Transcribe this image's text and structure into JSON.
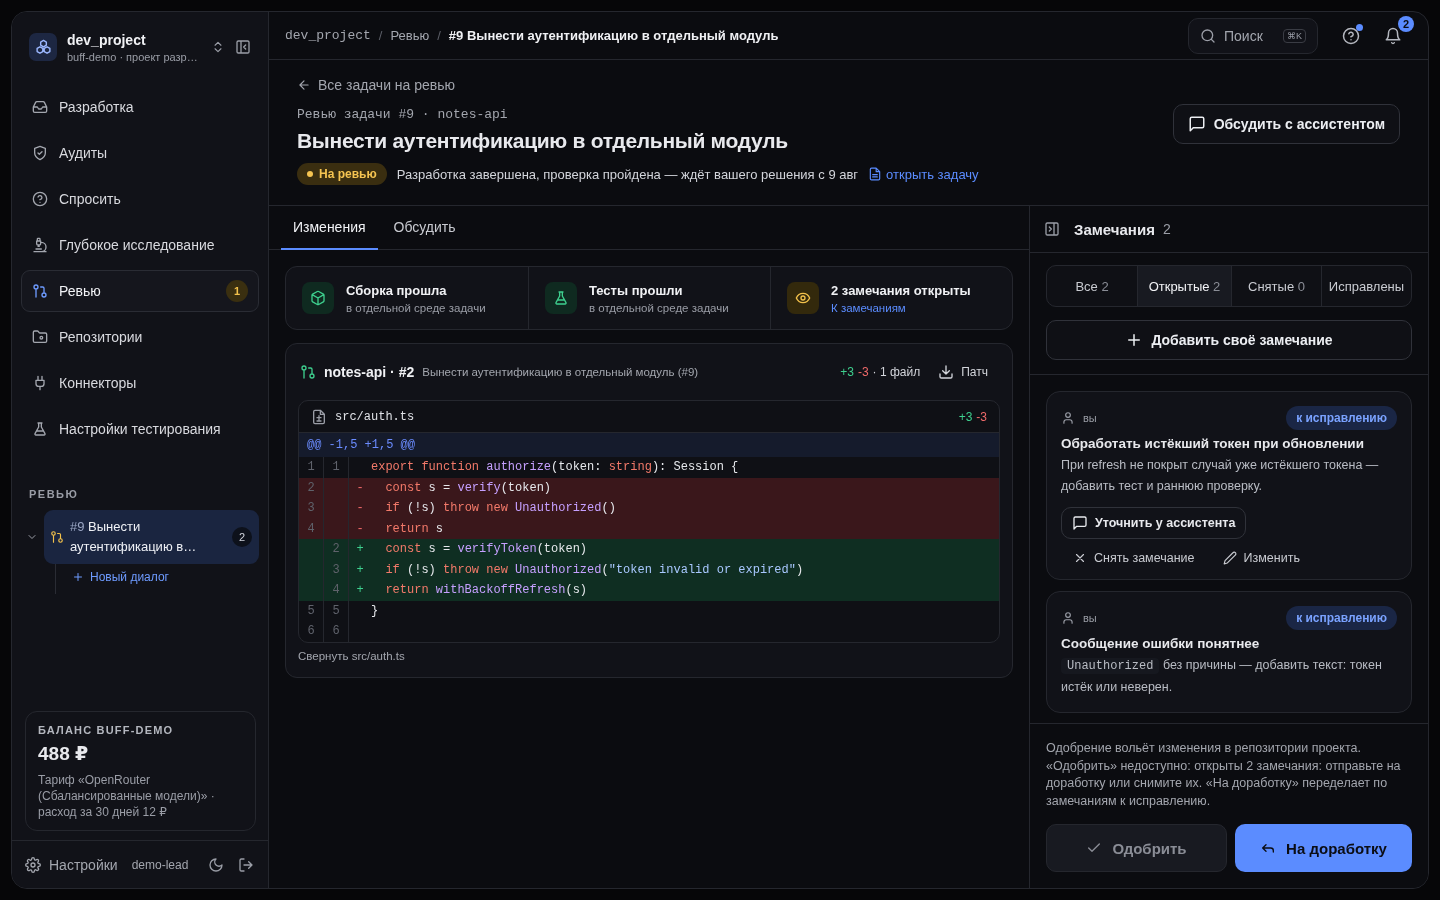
{
  "sidebar": {
    "project": {
      "name": "dev_project",
      "subtitle": "buff-demo · проект разр…"
    },
    "nav": [
      {
        "label": "Разработка",
        "selected": false
      },
      {
        "label": "Аудиты",
        "selected": false
      },
      {
        "label": "Спросить",
        "selected": false
      },
      {
        "label": "Глубокое исследование",
        "selected": false
      },
      {
        "label": "Ревью",
        "selected": true,
        "badge": "1"
      },
      {
        "label": "Репозитории",
        "selected": false
      },
      {
        "label": "Коннекторы",
        "selected": false
      },
      {
        "label": "Настройки тестирования",
        "selected": false
      }
    ],
    "section_title": "РЕВЬЮ",
    "tree": [
      {
        "number": "#9",
        "title": "Вынести аутентификацию в…",
        "badge": "2",
        "selected": true,
        "expanded": true,
        "children": [
          {
            "label": "Новый диалог"
          }
        ]
      }
    ],
    "balance": {
      "title": "БАЛАНС BUFF-DEMO",
      "amount": "488 ₽",
      "note": "Тариф «OpenRouter (Сбалансированные модели)» · расход за 30 дней 12 ₽"
    },
    "footer": {
      "settings": "Настройки",
      "user": "demo-lead"
    }
  },
  "topbar": {
    "separator": "/",
    "breadcrumbs": [
      "dev_project",
      "Ревью",
      "#9 Вынести аутентификацию в отдельный модуль"
    ],
    "search": {
      "placeholder": "Поиск",
      "shortcut": "⌘K"
    },
    "help_unread": true,
    "notifications": "2"
  },
  "header": {
    "back": "Все задачи на ревью",
    "eyebrow": "Ревью задачи #9 · notes-api",
    "title": "Вынести аутентификацию в отдельный модуль",
    "status": "На ревью",
    "summary": "Разработка завершена, проверка пройдена — ждёт вашего решения с 9 авг",
    "task_link": "открыть задачу",
    "discuss_button": "Обсудить с ассистентом"
  },
  "tabs": [
    {
      "label": "Изменения",
      "selected": true
    },
    {
      "label": "Обсудить",
      "selected": false
    }
  ],
  "checks": [
    {
      "kind": "build",
      "title": "Сборка прошла",
      "subtitle": "в отдельной среде задачи"
    },
    {
      "kind": "tests",
      "title": "Тесты прошли",
      "subtitle": "в отдельной среде задачи"
    },
    {
      "kind": "remarks",
      "title": "2 замечания открыты",
      "link": "К замечаниям"
    }
  ],
  "diff": {
    "repo": "notes-api · #2",
    "description": "Вынести аутентификацию в отдельный модуль (#9)",
    "added": "+3",
    "removed": "-3",
    "files": "· 1 файл",
    "patch": "Патч",
    "file": {
      "path": "src/auth.ts",
      "added": "+3",
      "removed": "-3",
      "hunk": "@@ -1,5 +1,5 @@",
      "lines": [
        {
          "kind": "ctx",
          "old": "1",
          "new": "1",
          "code": [
            {
              "kind": "kw",
              "text": "export"
            },
            {
              "kind": "kw",
              "text": " function"
            },
            {
              "kind": "fn",
              "text": " authorize"
            },
            {
              "kind": "plain",
              "text": "(token: "
            },
            {
              "kind": "kw",
              "text": "string"
            },
            {
              "kind": "plain",
              "text": "): Session {"
            }
          ]
        },
        {
          "kind": "del",
          "old": "2",
          "sign": "-",
          "code": [
            {
              "kind": "kw",
              "text": "  const"
            },
            {
              "kind": "plain",
              "text": " s = "
            },
            {
              "kind": "fn",
              "text": "verify"
            },
            {
              "kind": "plain",
              "text": "(token)"
            }
          ]
        },
        {
          "kind": "del",
          "old": "3",
          "sign": "-",
          "code": [
            {
              "kind": "kw",
              "text": "  if"
            },
            {
              "kind": "plain",
              "text": " (!s) "
            },
            {
              "kind": "kw",
              "text": "throw"
            },
            {
              "kind": "kw",
              "text": " new"
            },
            {
              "kind": "fn",
              "text": " Unauthorized"
            },
            {
              "kind": "plain",
              "text": "()"
            }
          ]
        },
        {
          "kind": "del",
          "old": "4",
          "sign": "-",
          "code": [
            {
              "kind": "kw",
              "text": "  return"
            },
            {
              "kind": "plain",
              "text": " s"
            }
          ]
        },
        {
          "kind": "add",
          "new": "2",
          "sign": "+",
          "code": [
            {
              "kind": "kw",
              "text": "  const"
            },
            {
              "kind": "plain",
              "text": " s = "
            },
            {
              "kind": "fn",
              "text": "verifyToken"
            },
            {
              "kind": "plain",
              "text": "(token)"
            }
          ]
        },
        {
          "kind": "add",
          "new": "3",
          "sign": "+",
          "code": [
            {
              "kind": "kw",
              "text": "  if"
            },
            {
              "kind": "plain",
              "text": " (!s) "
            },
            {
              "kind": "kw",
              "text": "throw"
            },
            {
              "kind": "kw",
              "text": " new"
            },
            {
              "kind": "fn",
              "text": " Unauthorized"
            },
            {
              "kind": "plain",
              "text": "("
            },
            {
              "kind": "str",
              "text": "\"token invalid or expired\""
            },
            {
              "kind": "plain",
              "text": ")"
            }
          ]
        },
        {
          "kind": "add",
          "new": "4",
          "sign": "+",
          "code": [
            {
              "kind": "kw",
              "text": "  return"
            },
            {
              "kind": "fn",
              "text": " withBackoffRefresh"
            },
            {
              "kind": "plain",
              "text": "(s)"
            }
          ]
        },
        {
          "kind": "ctx",
          "old": "5",
          "new": "5",
          "code": [
            {
              "kind": "plain",
              "text": "}"
            }
          ]
        },
        {
          "kind": "ctx",
          "old": "6",
          "new": "6"
        }
      ]
    },
    "collapse": "Свернуть src/auth.ts"
  },
  "remarks_panel": {
    "title": "Замечания",
    "count": "2",
    "filters": [
      {
        "label": "Все",
        "count": "2",
        "selected": false
      },
      {
        "label": "Открытые",
        "count": "2",
        "selected": true
      },
      {
        "label": "Снятые",
        "count": "0",
        "selected": false
      },
      {
        "label": "Исправлены",
        "selected": false
      }
    ],
    "add_button": "Добавить своё замечание",
    "remarks": [
      {
        "author": "вы",
        "tag": "к исправлению",
        "title": "Обработать истёкший токен при обновлении",
        "body": [
          {
            "kind": "text",
            "text": "При refresh не покрыт случай уже истёкшего токена — добавить тест и раннюю проверку."
          }
        ],
        "ask_button": "Уточнить у ассистента",
        "dismiss": "Снять замечание",
        "edit": "Изменить"
      },
      {
        "author": "вы",
        "tag": "к исправлению",
        "title": "Сообщение ошибки понятнее",
        "body": [
          {
            "kind": "code",
            "text": "Unauthorized"
          },
          {
            "kind": "text",
            "text": " без причины — добавить текст: токен истёк или неверен."
          }
        ]
      }
    ],
    "notice": "Одобрение вольёт изменения в репозитории проекта. «Одобрить» недоступно: открыты 2 замечания: отправьте на доработку или снимите их. «На доработку» переделает по замечаниям к исправлению.",
    "approve": {
      "label": "Одобрить",
      "disabled": true
    },
    "rework": "На доработку"
  }
}
